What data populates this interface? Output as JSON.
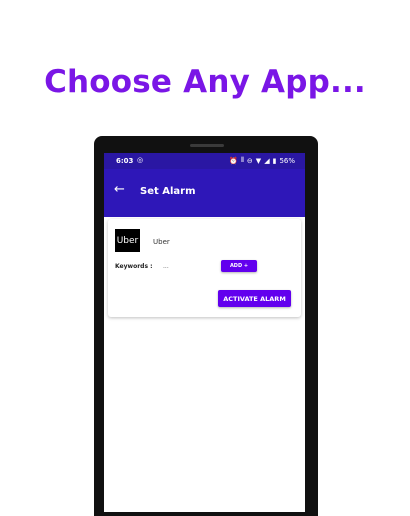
{
  "headline": "Choose Any App...",
  "status_bar": {
    "time": "6:03",
    "battery": "56%",
    "left_icon": "notification-icon",
    "right_icons": [
      "alarm-icon",
      "vibrate-icon",
      "dnd-icon",
      "wifi-icon",
      "signal-icon",
      "battery-icon"
    ]
  },
  "app_bar": {
    "title": "Set Alarm",
    "back_icon": "back-arrow-icon"
  },
  "card": {
    "logo_text": "Uber",
    "app_name": "Uber",
    "keywords_label": "Keywords :",
    "keywords_value": "...",
    "add_button": "ADD +",
    "activate_button": "ACTIVATE ALARM"
  },
  "colors": {
    "headline": "#7a16e6",
    "status_bar": "#2a17a3",
    "app_bar": "#2e17b8",
    "button": "#6200ee"
  }
}
